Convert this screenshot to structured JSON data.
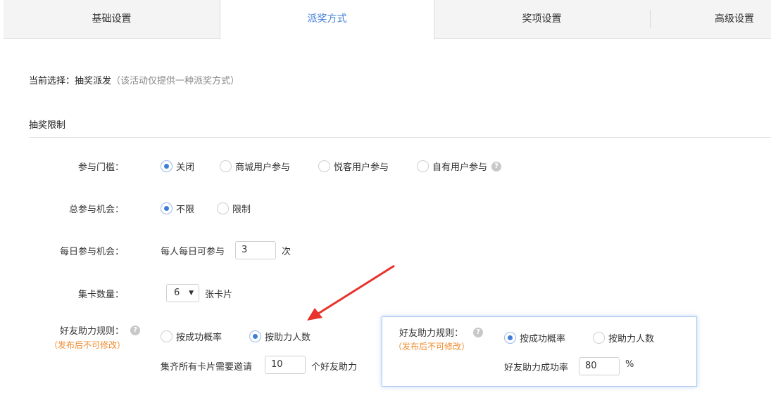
{
  "tabs": [
    {
      "label": "基础设置"
    },
    {
      "label": "派奖方式"
    },
    {
      "label": "奖项设置"
    },
    {
      "label": "高级设置"
    }
  ],
  "current": {
    "prefix": "当前选择：抽奖派发",
    "note": "（该活动仅提供一种派奖方式）"
  },
  "section_title": "抽奖限制",
  "threshold": {
    "label": "参与门槛：",
    "options": [
      "关闭",
      "商城用户参与",
      "悦客用户参与",
      "自有用户参与"
    ],
    "selected": "关闭"
  },
  "total_chance": {
    "label": "总参与机会：",
    "options": [
      "不限",
      "限制"
    ],
    "selected": "不限"
  },
  "daily_chance": {
    "label": "每日参与机会：",
    "prefix": "每人每日可参与",
    "value": "3",
    "suffix": "次"
  },
  "card_count": {
    "label": "集卡数量：",
    "value": "6",
    "suffix": "张卡片"
  },
  "friend_rule": {
    "label": "好友助力规则：",
    "note": "（发布后不可修改）",
    "options": [
      "按成功概率",
      "按助力人数"
    ],
    "selected": "按助力人数",
    "invite_prefix": "集齐所有卡片需要邀请",
    "invite_value": "10",
    "invite_suffix": "个好友助力"
  },
  "popup": {
    "label": "好友助力规则：",
    "note": "（发布后不可修改）",
    "options": [
      "按成功概率",
      "按助力人数"
    ],
    "selected": "按成功概率",
    "rate_label": "好友助力成功率",
    "rate_value": "80",
    "rate_suffix": "%"
  },
  "colors": {
    "accent": "#3f7fd8",
    "warning": "#f08a2c",
    "arrow": "#e8322c"
  }
}
